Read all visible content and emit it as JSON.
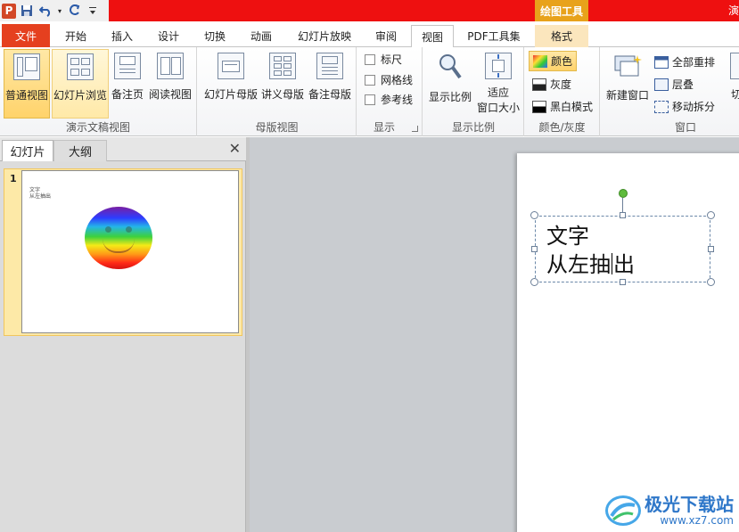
{
  "titlebar": {
    "context_tab": "绘图工具",
    "title_fragment": "演"
  },
  "tabs": {
    "file": "文件",
    "home": "开始",
    "insert": "插入",
    "design": "设计",
    "transitions": "切换",
    "animations": "动画",
    "slideshow": "幻灯片放映",
    "review": "审阅",
    "view": "视图",
    "pdf": "PDF工具集",
    "format": "格式"
  },
  "ribbon": {
    "presentation_views": {
      "label": "演示文稿视图",
      "normal": "普通视图",
      "sorter": "幻灯片浏览",
      "notes": "备注页",
      "reading": "阅读视图"
    },
    "master_views": {
      "label": "母版视图",
      "slide_master": "幻灯片母版",
      "handout_master": "讲义母版",
      "notes_master": "备注母版"
    },
    "show": {
      "label": "显示",
      "ruler": "标尺",
      "gridlines": "网格线",
      "guides": "参考线"
    },
    "zoom": {
      "label": "显示比例",
      "zoom": "显示比例",
      "fit_line1": "适应",
      "fit_line2": "窗口大小"
    },
    "color": {
      "label": "颜色/灰度",
      "color": "颜色",
      "grayscale": "灰度",
      "bw": "黑白模式"
    },
    "window": {
      "label": "窗口",
      "new_window": "新建窗口",
      "arrange_all": "全部重排",
      "cascade": "层叠",
      "move_split": "移动拆分",
      "switch_partial": "切换"
    }
  },
  "left_pane": {
    "tab_slides": "幻灯片",
    "tab_outline": "大纲",
    "close": "✕",
    "slide_number": "1",
    "thumb_text_line1": "文字",
    "thumb_text_line2": "从左抽出"
  },
  "slide": {
    "text_line1": "文字",
    "text_line2_a": "从左抽",
    "text_line2_b": "出"
  },
  "watermark": {
    "name": "极光下载站",
    "url": "www.xz7.com"
  }
}
